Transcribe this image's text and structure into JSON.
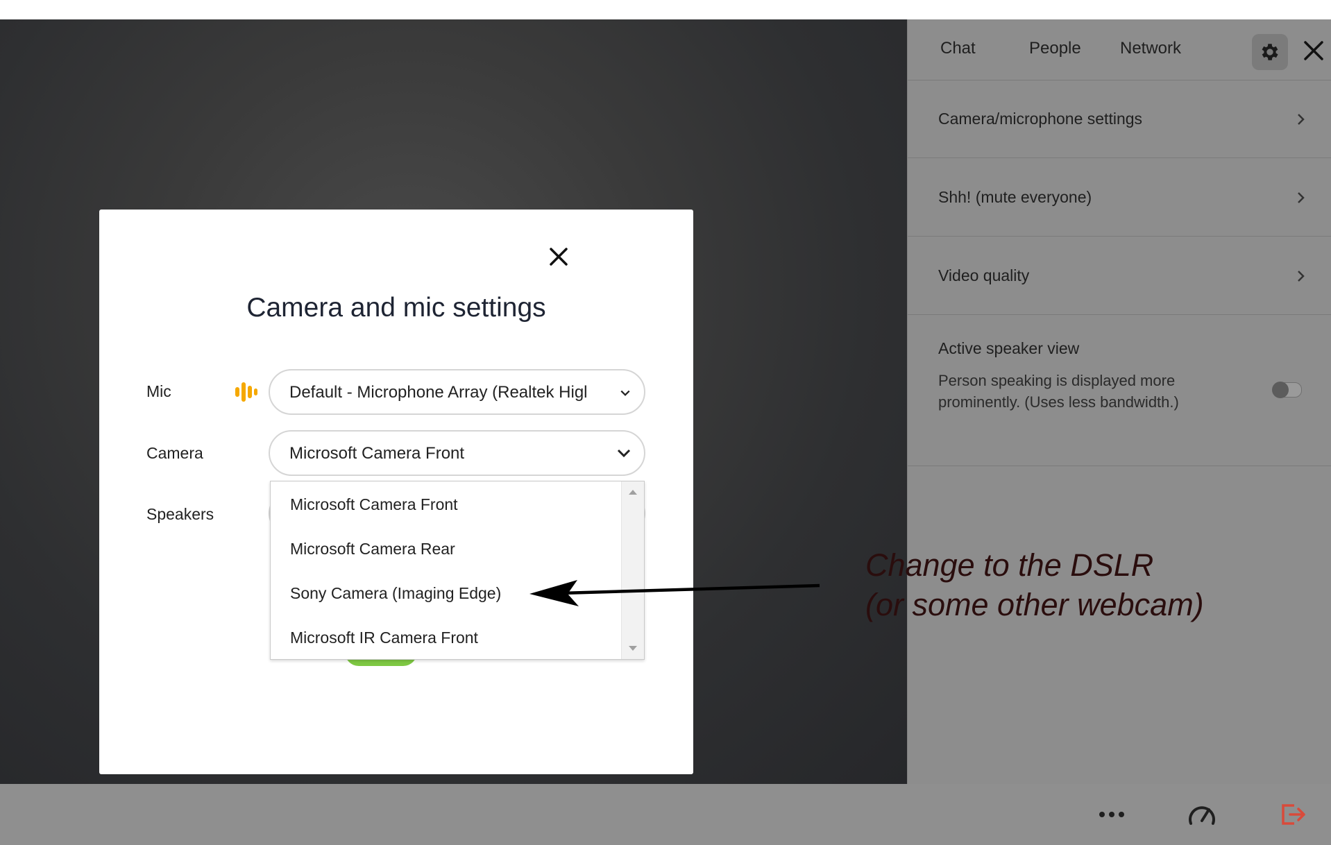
{
  "side_panel": {
    "tabs": [
      "Chat",
      "People",
      "Network"
    ],
    "menu": [
      {
        "label": "Camera/microphone settings"
      },
      {
        "label": "Shh! (mute everyone)"
      },
      {
        "label": "Video quality"
      }
    ],
    "active_speaker": {
      "title": "Active speaker view",
      "description": "Person speaking is displayed more prominently. (Uses less bandwidth.)",
      "enabled": false
    }
  },
  "modal": {
    "title": "Camera and mic settings",
    "mic": {
      "label": "Mic",
      "value": "Default - Microphone Array (Realtek Higl"
    },
    "camera": {
      "label": "Camera",
      "value": "Microsoft Camera Front"
    },
    "speakers": {
      "label": "Speakers"
    },
    "camera_options": [
      "Microsoft Camera Front",
      "Microsoft Camera Rear",
      "Sony Camera (Imaging Edge)",
      "Microsoft IR Camera Front"
    ]
  },
  "annotation": {
    "line1": "Change to the DSLR",
    "line2": "(or some other webcam)"
  },
  "colors": {
    "mic_level": "#f5a800",
    "leave_icon": "#d94a3a",
    "green_button": "#7ec843"
  },
  "bottom_bar": {
    "icons": [
      "more-icon",
      "speed-gauge-icon",
      "leave-icon"
    ]
  }
}
